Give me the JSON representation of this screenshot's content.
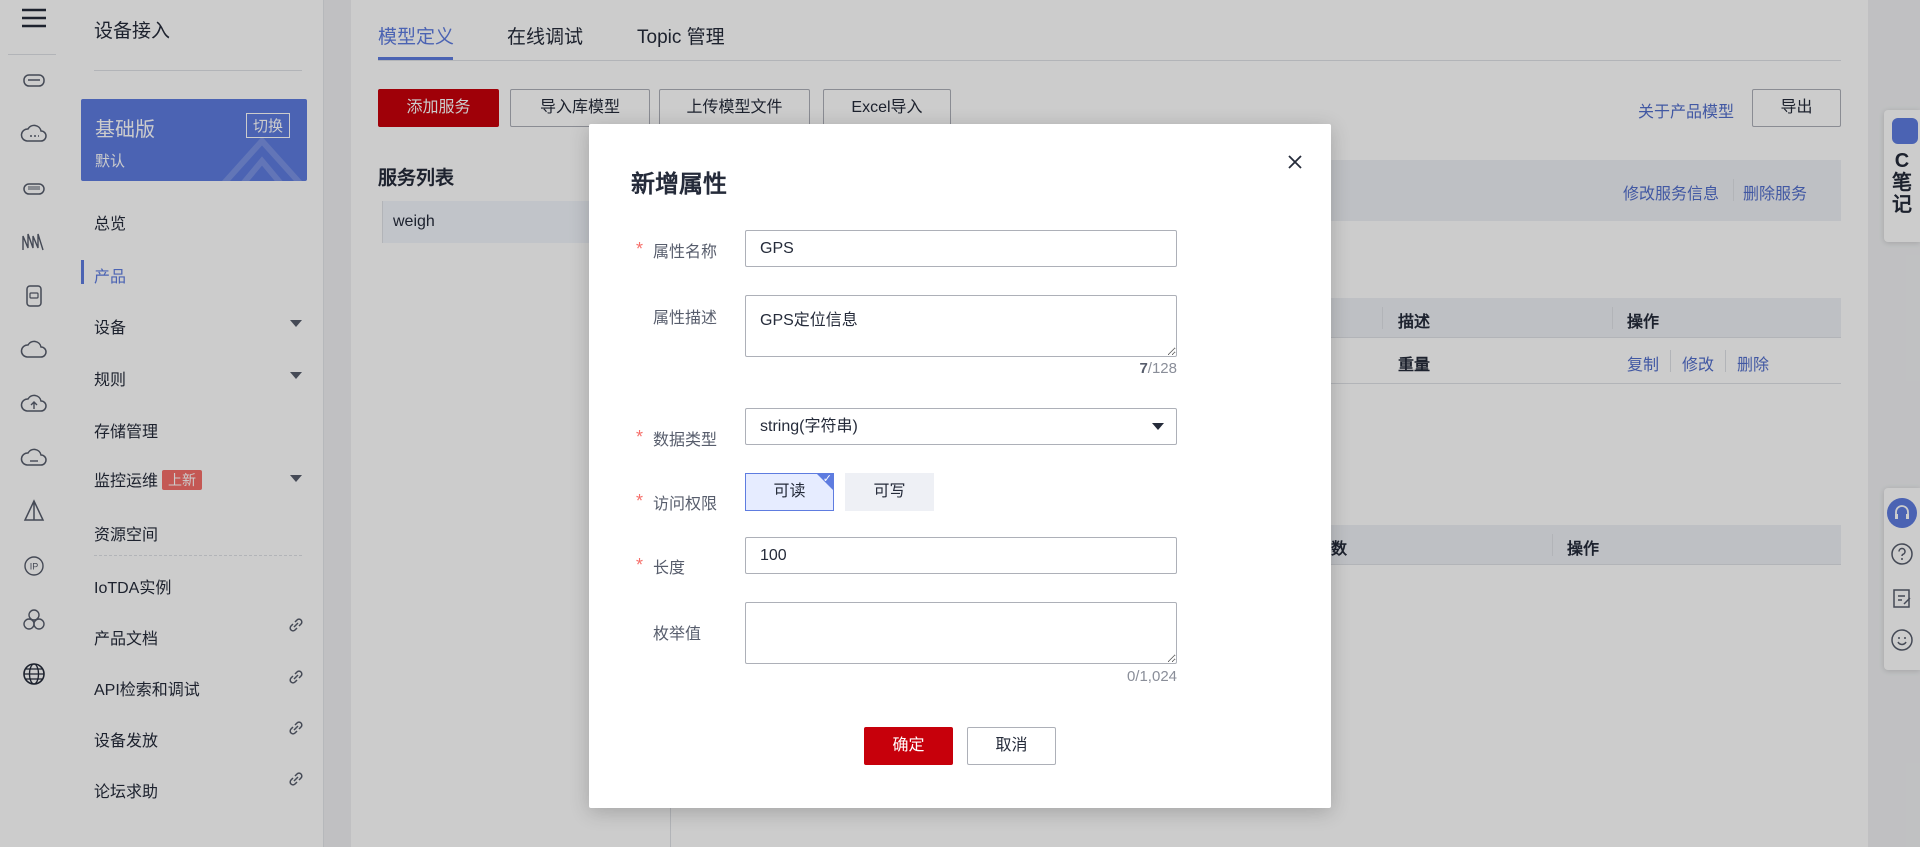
{
  "sidebar": {
    "title": "设备接入",
    "edition": {
      "name": "基础版",
      "switch_label": "切换",
      "instance": "默认"
    },
    "items": [
      {
        "label": "总览"
      },
      {
        "label": "产品"
      },
      {
        "label": "设备"
      },
      {
        "label": "规则"
      },
      {
        "label": "存储管理"
      },
      {
        "label": "监控运维",
        "badge": "上新"
      },
      {
        "label": "资源空间"
      },
      {
        "label": "IoTDA实例"
      },
      {
        "label": "产品文档"
      },
      {
        "label": "API检索和调试"
      },
      {
        "label": "设备发放"
      },
      {
        "label": "论坛求助"
      }
    ]
  },
  "tabs": [
    {
      "label": "模型定义"
    },
    {
      "label": "在线调试"
    },
    {
      "label": "Topic 管理"
    }
  ],
  "toolbar": {
    "add_service": "添加服务",
    "import_model": "导入库模型",
    "upload_model": "上传模型文件",
    "excel_import": "Excel导入",
    "about_model": "关于产品模型",
    "export": "导出"
  },
  "services": {
    "title": "服务列表",
    "items": [
      {
        "name": "weigh"
      }
    ],
    "edit_service": "修改服务信息",
    "delete_service": "删除服务"
  },
  "property_table": {
    "headers": [
      "描述",
      "操作"
    ],
    "rows": [
      {
        "description": "重量",
        "actions": [
          "复制",
          "修改",
          "删除"
        ]
      }
    ]
  },
  "command_table": {
    "headers": [
      "数",
      "操作"
    ]
  },
  "right_float": {
    "note_text": "C笔记"
  },
  "modal": {
    "title": "新增属性",
    "fields": {
      "name": {
        "label": "属性名称",
        "value": "GPS"
      },
      "description": {
        "label": "属性描述",
        "value": "GPS定位信息",
        "count": "7",
        "max": "/128"
      },
      "data_type": {
        "label": "数据类型",
        "value": "string(字符串)"
      },
      "access": {
        "label": "访问权限",
        "options": [
          "可读",
          "可写"
        ],
        "selected": "可读"
      },
      "length": {
        "label": "长度",
        "value": "100"
      },
      "enum": {
        "label": "枚举值",
        "value": "",
        "counter": "0/1,024"
      }
    },
    "confirm": "确定",
    "cancel": "取消"
  },
  "colors": {
    "primary_red": "#c7000b",
    "brand_blue": "#5e7ce0",
    "link_blue": "#526ecc",
    "required_red": "#f66f6a"
  }
}
